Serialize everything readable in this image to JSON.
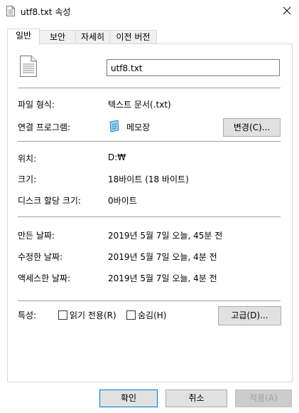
{
  "window": {
    "title": "utf8.txt 속성"
  },
  "tabs": [
    {
      "label": "일반",
      "active": true
    },
    {
      "label": "보안",
      "active": false
    },
    {
      "label": "자세히",
      "active": false
    },
    {
      "label": "이전 버전",
      "active": false
    }
  ],
  "general": {
    "file_name": "utf8.txt",
    "file_type_label": "파일 형식:",
    "file_type_value": "텍스트 문서(.txt)",
    "opens_with_label": "연결 프로그램:",
    "opens_with_value": "메모장",
    "change_button": "변경(C)...",
    "location_label": "위치:",
    "location_value": "D:₩",
    "size_label": "크기:",
    "size_value": "18바이트 (18 바이트)",
    "size_on_disk_label": "디스크 할당 크기:",
    "size_on_disk_value": "0바이트",
    "created_label": "만든 날짜:",
    "created_value": "2019년 5월 7일 오늘, 45분 전",
    "modified_label": "수정한 날짜:",
    "modified_value": "2019년 5월 7일 오늘, 4분 전",
    "accessed_label": "액세스한 날짜:",
    "accessed_value": "2019년 5월 7일 오늘, 4분 전",
    "attributes_label": "특성:",
    "readonly_label": "읽기 전용(R)",
    "readonly_checked": false,
    "hidden_label": "숨김(H)",
    "hidden_checked": false,
    "advanced_button": "고급(D)..."
  },
  "footer": {
    "ok_button": "확인",
    "cancel_button": "취소",
    "apply_button": "적용(A)"
  },
  "colors": {
    "primary_border": "#0078d7",
    "button_bg": "#e1e1e1",
    "disabled_text": "#a0a0a0"
  },
  "icons": {
    "title": "text-file-icon",
    "close": "close-icon",
    "file": "text-file-icon",
    "program": "notepad-icon"
  }
}
